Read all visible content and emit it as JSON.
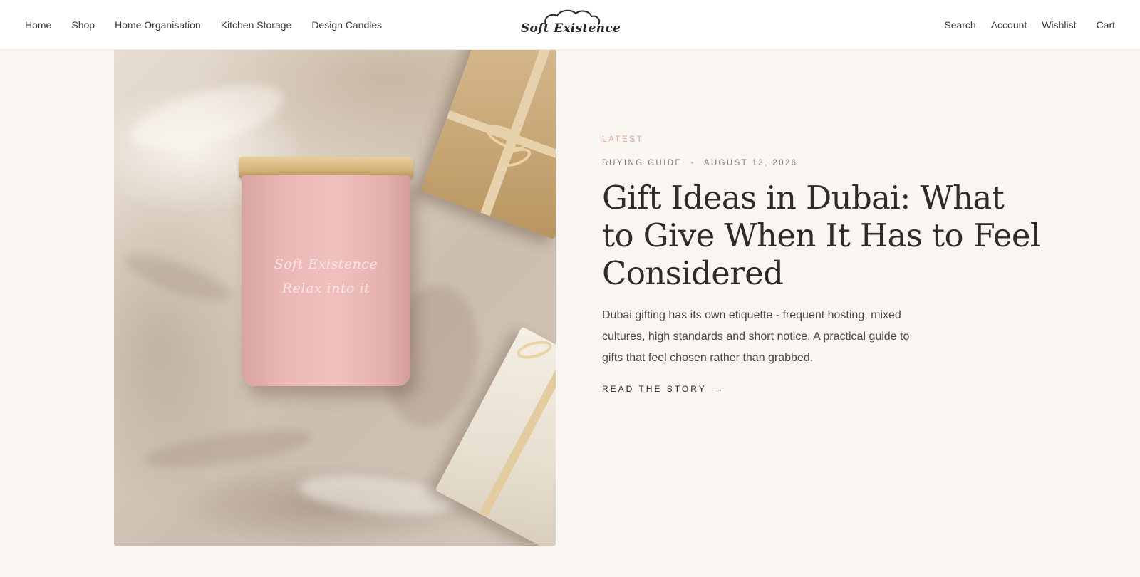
{
  "nav": {
    "left": [
      "Home",
      "Shop",
      "Home Organisation",
      "Kitchen Storage",
      "Design Candles"
    ],
    "right": {
      "search": "Search",
      "account": "Account",
      "wishlist": "Wishlist",
      "cart": "Cart"
    }
  },
  "brand": {
    "logo_text": "Soft Existence"
  },
  "hero": {
    "candle_label_line1": "Soft Existence",
    "candle_label_line2": "Relax into it"
  },
  "article": {
    "eyebrow": "LATEST",
    "category": "BUYING GUIDE",
    "date": "AUGUST 13, 2026",
    "title": "Gift Ideas in Dubai: What to Give When It Has to Feel Considered",
    "excerpt": "Dubai gifting has its own etiquette - frequent hosting, mixed cultures, high standards and short notice. A practical guide to gifts that feel chosen rather than grabbed.",
    "cta": "READ THE STORY",
    "cta_arrow": "→"
  },
  "colors": {
    "page_background": "#f9f6f1",
    "header_background": "#ffffff",
    "eyebrow_accent": "#d9a79c",
    "text_primary": "#2e2b28",
    "candle_pink": "#eab7b6"
  }
}
